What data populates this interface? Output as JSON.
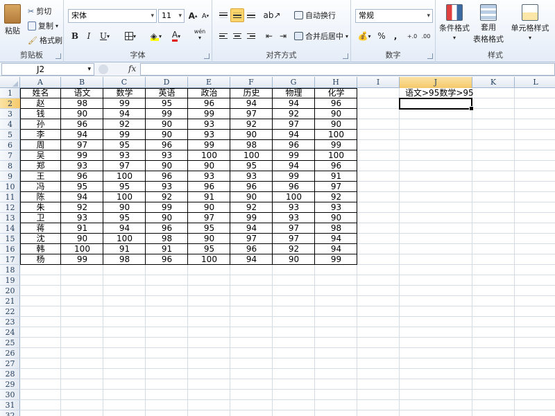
{
  "ribbon": {
    "clipboard": {
      "label": "剪贴板",
      "paste": "粘贴",
      "cut": "剪切",
      "copy": "复制",
      "format_painter": "格式刷"
    },
    "font": {
      "label": "字体",
      "name": "宋体",
      "size": "11",
      "bold": "B",
      "italic": "I",
      "underline": "U",
      "grow": "A",
      "shrink": "A",
      "color_glyph": "A",
      "phonetic": "wén"
    },
    "alignment": {
      "label": "对齐方式",
      "wrap_text": "自动换行",
      "merge_center": "合并后居中"
    },
    "number": {
      "label": "数字",
      "format": "常规",
      "percent": "%",
      "comma": ",",
      "inc_decimal": "+.0\n.00",
      "dec_decimal": ".00\n→.0"
    },
    "styles": {
      "label": "样式",
      "conditional": "条件格式",
      "table_format_1": "套用",
      "table_format_2": "表格格式",
      "cell_styles": "单元格样式"
    }
  },
  "formula_bar": {
    "name_box": "J2",
    "fx": "fx",
    "formula": ""
  },
  "columns": [
    "A",
    "B",
    "C",
    "D",
    "E",
    "F",
    "G",
    "H",
    "I",
    "J",
    "K",
    "L"
  ],
  "selected_column": "J",
  "selected_row": 2,
  "row_count": 32,
  "table": {
    "headers": [
      "姓名",
      "语文",
      "数学",
      "英语",
      "政治",
      "历史",
      "物理",
      "化学"
    ],
    "rows": [
      [
        "赵",
        "98",
        "99",
        "95",
        "96",
        "94",
        "94",
        "96"
      ],
      [
        "钱",
        "90",
        "94",
        "99",
        "99",
        "97",
        "92",
        "90"
      ],
      [
        "孙",
        "96",
        "92",
        "90",
        "93",
        "92",
        "97",
        "90"
      ],
      [
        "李",
        "94",
        "99",
        "90",
        "93",
        "90",
        "94",
        "100"
      ],
      [
        "周",
        "97",
        "95",
        "96",
        "99",
        "98",
        "96",
        "99"
      ],
      [
        "吴",
        "99",
        "93",
        "93",
        "100",
        "100",
        "99",
        "100"
      ],
      [
        "郑",
        "93",
        "97",
        "90",
        "90",
        "95",
        "94",
        "96"
      ],
      [
        "王",
        "96",
        "100",
        "96",
        "93",
        "93",
        "99",
        "91"
      ],
      [
        "冯",
        "95",
        "95",
        "93",
        "96",
        "96",
        "96",
        "97"
      ],
      [
        "陈",
        "94",
        "100",
        "92",
        "91",
        "90",
        "100",
        "92"
      ],
      [
        "朱",
        "92",
        "90",
        "99",
        "90",
        "92",
        "93",
        "93"
      ],
      [
        "卫",
        "93",
        "95",
        "90",
        "97",
        "99",
        "93",
        "90"
      ],
      [
        "蒋",
        "91",
        "94",
        "96",
        "95",
        "94",
        "97",
        "98"
      ],
      [
        "沈",
        "90",
        "100",
        "98",
        "90",
        "97",
        "97",
        "94"
      ],
      [
        "韩",
        "100",
        "91",
        "91",
        "95",
        "96",
        "92",
        "94"
      ],
      [
        "杨",
        "99",
        "98",
        "96",
        "100",
        "94",
        "90",
        "99"
      ]
    ]
  },
  "criteria_cell": "语文>95数学>95"
}
